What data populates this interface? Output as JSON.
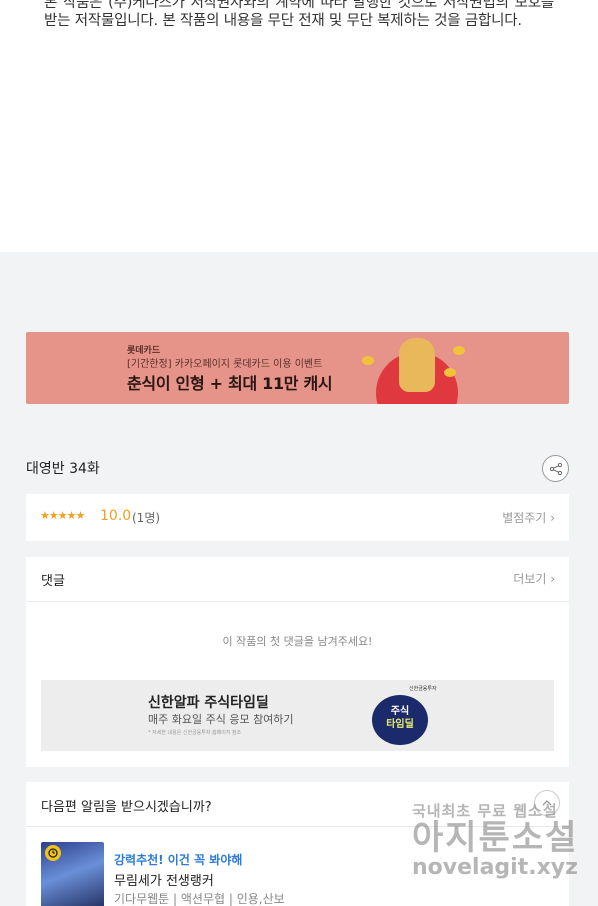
{
  "notice": {
    "text": "본 작품은 (주)케나즈가 저작권자와의 계약에 따라 발행한 것으로 저작권법의 보호를 받는 저작물입니다. 본 작품의 내용을 무단 전재 및 무단 복제하는 것을 금합니다."
  },
  "ad_banner": {
    "brand": "롯데카드",
    "subtitle": "[기간한정] 카카오페이지 롯데카드 이용 이벤트",
    "headline": "춘식이 인형 + 최대 11만 캐시",
    "bg_color": "#e6948a"
  },
  "episode": {
    "title": "대영반 34화",
    "share_icon": "share-icon"
  },
  "rating": {
    "stars": "★★★★★",
    "score": "10.0",
    "count": "(1명)",
    "rate_label": "별점주기"
  },
  "comments": {
    "title": "댓글",
    "more_label": "더보기",
    "empty_message": "이 작품의 첫 댓글을 남겨주세요!"
  },
  "ad_box": {
    "title": "신한알파 주식타임딜",
    "subtitle": "매주 화요일 주식 응모 참여하기",
    "fine_print": "* 자세한 내용은 신한금융투자 홈페이지 참조",
    "logo_text": "신한금융투자",
    "badge_line1": "주식",
    "badge_line2": "타임딜"
  },
  "next_episode": {
    "title": "다음편 알림을 받으시겠습니까?",
    "rec_tag": "강력추천! 이건 꼭 봐야해",
    "rec_title": "무림세가 전생랭커",
    "rec_genre": "기다무웹툰 | 액션무협 | 인용,산보"
  },
  "watermark": {
    "line1": "국내최초 무료 웹소설",
    "line2": "아지툰소설",
    "line3": "novelagit.xyz"
  },
  "colors": {
    "accent_orange": "#f0a020",
    "accent_blue": "#2a7cd8",
    "page_bg": "#f2f3f5"
  }
}
